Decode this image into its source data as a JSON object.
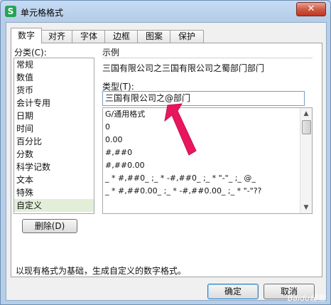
{
  "window": {
    "title": "单元格格式",
    "close_label": "✕",
    "app_icon_letter": "S"
  },
  "tabs": [
    {
      "label": "数字"
    },
    {
      "label": "对齐"
    },
    {
      "label": "字体"
    },
    {
      "label": "边框"
    },
    {
      "label": "图案"
    },
    {
      "label": "保护"
    }
  ],
  "category": {
    "label": "分类(C):",
    "items": [
      "常规",
      "数值",
      "货币",
      "会计专用",
      "日期",
      "时间",
      "百分比",
      "分数",
      "科学记数",
      "文本",
      "特殊",
      "自定义"
    ],
    "selected": "自定义",
    "delete_label": "删除(D)"
  },
  "sample": {
    "title": "示例",
    "text": "三国有限公司之三国有限公司之蜀部门部门"
  },
  "type": {
    "label": "类型(T):",
    "value": "三国有限公司之@部门",
    "formats": [
      "G/通用格式",
      "0",
      "0.00",
      "#,##0",
      "#,##0.00",
      "_ * #,##0_ ;_ * -#,##0_ ;_ * \"-\"_ ;_ @_",
      "_ * #,##0.00_ ;_ * -#,##0.00_ ;_ * \"-\"??"
    ]
  },
  "description": "以现有格式为基础，生成自定义的数字格式。",
  "buttons": {
    "ok": "确定",
    "cancel": "取消"
  },
  "watermark": "Baidu经验",
  "colors": {
    "arrow": "#e8175d",
    "selection": "#e2eed8",
    "title_bg": "#b9d1ea"
  }
}
